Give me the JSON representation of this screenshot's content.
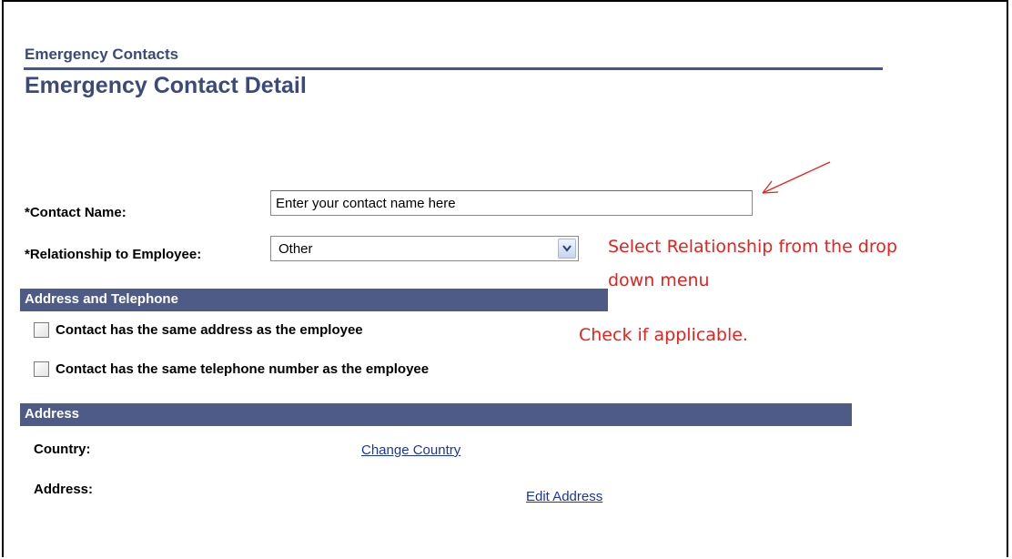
{
  "header": {
    "section_title": "Emergency Contacts",
    "page_title": "Emergency Contact Detail"
  },
  "form": {
    "contact_name_label": "*Contact Name:",
    "contact_name_value": "Enter your contact name here",
    "relationship_label": "*Relationship to Employee:",
    "relationship_value": "Other"
  },
  "address_telephone": {
    "heading": "Address and Telephone",
    "same_address_label": "Contact has the same address as the employee",
    "same_address_checked": false,
    "same_phone_label": "Contact has the same telephone number as the employee",
    "same_phone_checked": false
  },
  "address": {
    "heading": "Address",
    "country_label": "Country:",
    "change_country_link": "Change Country",
    "address_label": "Address:",
    "edit_address_link": "Edit Address"
  },
  "annotations": {
    "relationship_note_line1": "Select Relationship from the drop",
    "relationship_note_line2": "down menu",
    "checkbox_note": "Check if applicable."
  },
  "colors": {
    "band": "#4d5b86",
    "title": "#3c4a7a",
    "link": "#1a35a8",
    "annotation": "#e8211c"
  }
}
